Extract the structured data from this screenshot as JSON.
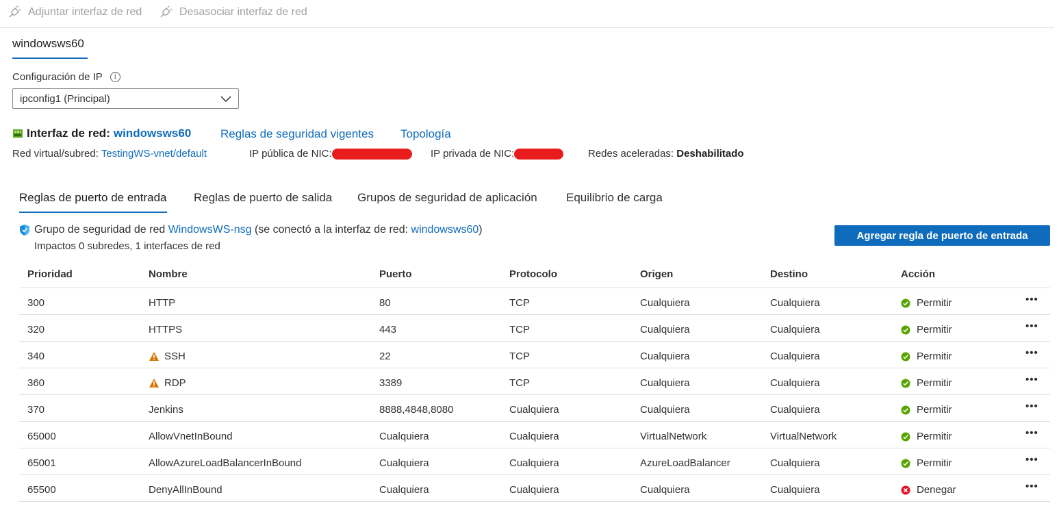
{
  "toolbar": {
    "attach_label": "Adjuntar interfaz de red",
    "detach_label": "Desasociar interfaz de red"
  },
  "vm_tab": "windowsws60",
  "ip_config": {
    "label": "Configuración de IP",
    "selected": "ipconfig1 (Principal)"
  },
  "nic": {
    "title": "Interfaz de red:",
    "name": "windowsws60",
    "effective_rules_link": "Reglas de seguridad vigentes",
    "topology_link": "Topología",
    "vnet_label": "Red virtual/subred:",
    "vnet_value": "TestingWS-vnet/default",
    "public_ip_label": "IP pública de NIC:",
    "private_ip_label": "IP privada de NIC:",
    "accel_label": "Redes aceleradas:",
    "accel_value": "Deshabilitado"
  },
  "tabs": [
    {
      "label": "Reglas de puerto de entrada",
      "active": true
    },
    {
      "label": "Reglas de puerto de salida",
      "active": false
    },
    {
      "label": "Grupos de seguridad de aplicación",
      "active": false
    },
    {
      "label": "Equilibrio de carga",
      "active": false
    }
  ],
  "nsg": {
    "prefix": "Grupo de seguridad de red",
    "name": "WindowsWS-nsg",
    "middle": "(se conectó a la interfaz de red:",
    "nic_link": "windowsws60",
    "suffix": ")",
    "impacts": "Impactos 0 subredes, 1 interfaces de red"
  },
  "add_button": "Agregar regla de puerto de entrada",
  "table": {
    "headers": [
      "Prioridad",
      "Nombre",
      "Puerto",
      "Protocolo",
      "Origen",
      "Destino",
      "Acción"
    ],
    "rows": [
      {
        "priority": "300",
        "name": "HTTP",
        "warning": false,
        "port": "80",
        "protocol": "TCP",
        "source": "Cualquiera",
        "destination": "Cualquiera",
        "action": "Permitir",
        "allow": true
      },
      {
        "priority": "320",
        "name": "HTTPS",
        "warning": false,
        "port": "443",
        "protocol": "TCP",
        "source": "Cualquiera",
        "destination": "Cualquiera",
        "action": "Permitir",
        "allow": true
      },
      {
        "priority": "340",
        "name": "SSH",
        "warning": true,
        "port": "22",
        "protocol": "TCP",
        "source": "Cualquiera",
        "destination": "Cualquiera",
        "action": "Permitir",
        "allow": true
      },
      {
        "priority": "360",
        "name": "RDP",
        "warning": true,
        "port": "3389",
        "protocol": "TCP",
        "source": "Cualquiera",
        "destination": "Cualquiera",
        "action": "Permitir",
        "allow": true
      },
      {
        "priority": "370",
        "name": "Jenkins",
        "warning": false,
        "port": "8888,4848,8080",
        "protocol": "Cualquiera",
        "source": "Cualquiera",
        "destination": "Cualquiera",
        "action": "Permitir",
        "allow": true
      },
      {
        "priority": "65000",
        "name": "AllowVnetInBound",
        "warning": false,
        "port": "Cualquiera",
        "protocol": "Cualquiera",
        "source": "VirtualNetwork",
        "destination": "VirtualNetwork",
        "action": "Permitir",
        "allow": true
      },
      {
        "priority": "65001",
        "name": "AllowAzureLoadBalancerInBound",
        "warning": false,
        "port": "Cualquiera",
        "protocol": "Cualquiera",
        "source": "AzureLoadBalancer",
        "destination": "Cualquiera",
        "action": "Permitir",
        "allow": true
      },
      {
        "priority": "65500",
        "name": "DenyAllInBound",
        "warning": false,
        "port": "Cualquiera",
        "protocol": "Cualquiera",
        "source": "Cualquiera",
        "destination": "Cualquiera",
        "action": "Denegar",
        "allow": false
      }
    ],
    "more_label": "•••"
  },
  "colors": {
    "accent": "#0f6cbd",
    "allow": "#57a300",
    "deny": "#e81123",
    "warning": "#d47500",
    "redaction": "#e81c1c"
  },
  "icons": {
    "toolbar": "plug-icon",
    "info": "info-icon",
    "nic": "network-interface-icon",
    "nsg": "shield-icon",
    "warning": "warning-icon",
    "allow": "check-circle-icon",
    "deny": "error-circle-icon",
    "more": "more-icon"
  }
}
